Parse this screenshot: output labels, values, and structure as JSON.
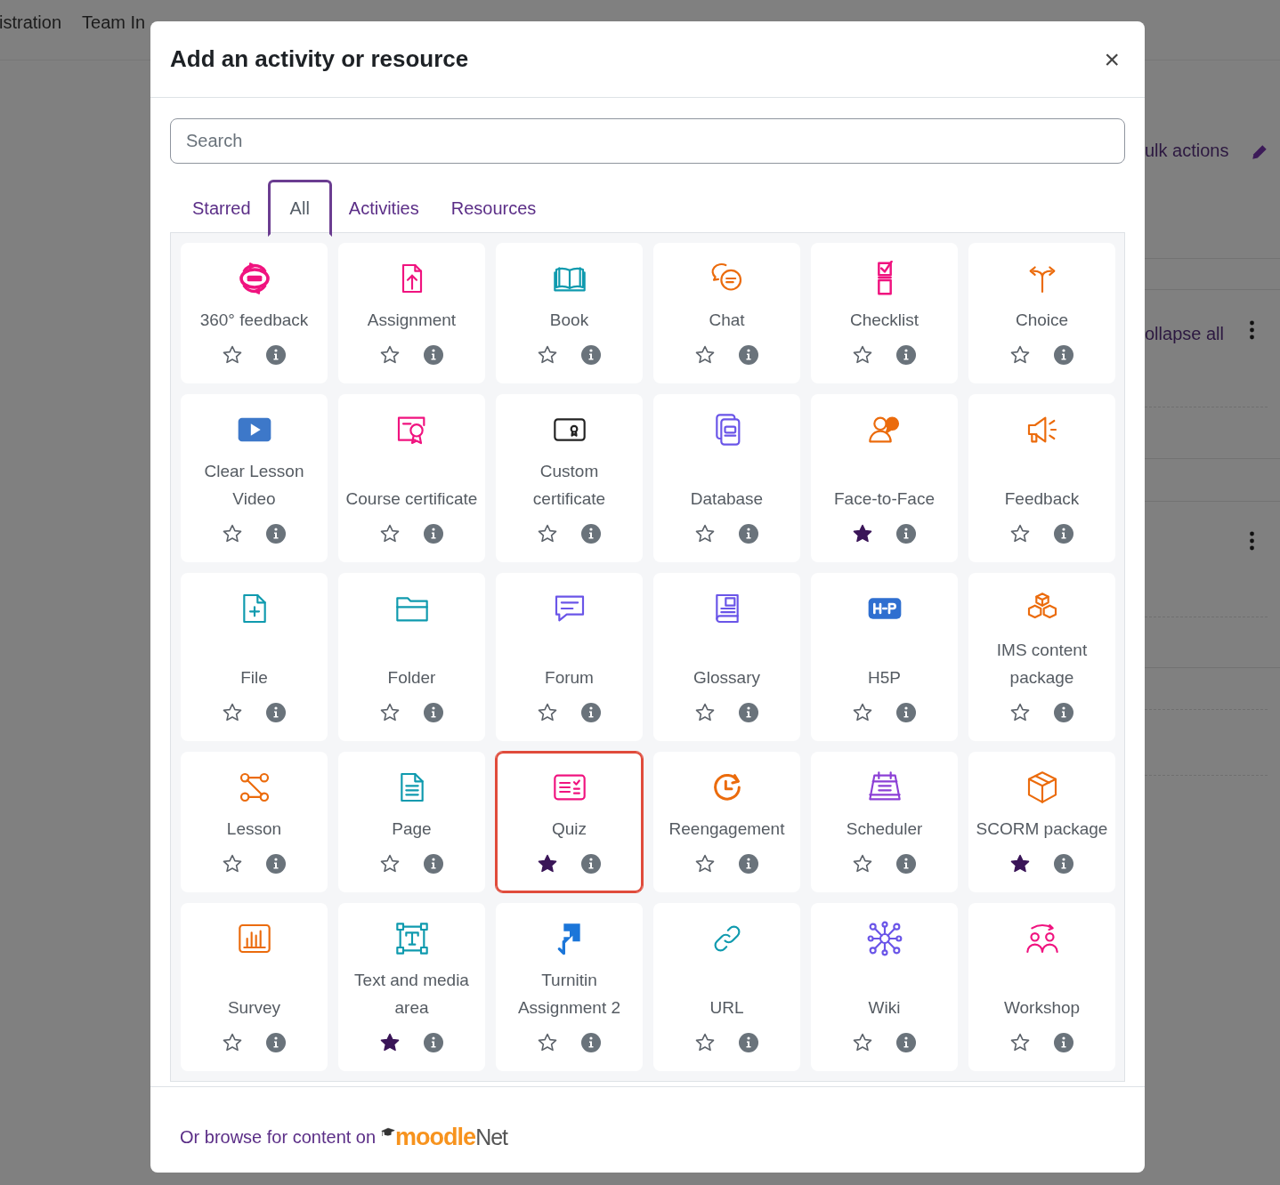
{
  "background": {
    "nav_items": [
      "istration",
      "Team In"
    ],
    "bulk_actions": "ulk actions",
    "collapse_all": "ollapse all"
  },
  "modal": {
    "title": "Add an activity or resource",
    "close": "×",
    "search": {
      "placeholder": "Search"
    },
    "tabs": [
      {
        "label": "Starred",
        "selected": false
      },
      {
        "label": "All",
        "selected": true
      },
      {
        "label": "Activities",
        "selected": false
      },
      {
        "label": "Resources",
        "selected": false
      }
    ],
    "items": [
      {
        "name": "360° feedback",
        "kind": "circular",
        "color": "#f0137f",
        "starred": false,
        "selected": false
      },
      {
        "name": "Assignment",
        "kind": "assign",
        "color": "#f0137f",
        "starred": false,
        "selected": false
      },
      {
        "name": "Book",
        "kind": "book",
        "color": "#0f9aae",
        "starred": false,
        "selected": false
      },
      {
        "name": "Chat",
        "kind": "chat",
        "color": "#eb6b0c",
        "starred": false,
        "selected": false
      },
      {
        "name": "Checklist",
        "kind": "checklist",
        "color": "#f0137f",
        "starred": false,
        "selected": false
      },
      {
        "name": "Choice",
        "kind": "choice",
        "color": "#eb6b0c",
        "starred": false,
        "selected": false
      },
      {
        "name": "Clear Lesson Video",
        "kind": "video",
        "color": "#3d78c9",
        "starred": false,
        "selected": false
      },
      {
        "name": "Course certificate",
        "kind": "cert",
        "color": "#f0137f",
        "starred": false,
        "selected": false
      },
      {
        "name": "Custom certificate",
        "kind": "custcert",
        "color": "#222222",
        "starred": false,
        "selected": false
      },
      {
        "name": "Database",
        "kind": "database",
        "color": "#6a55e8",
        "starred": false,
        "selected": false
      },
      {
        "name": "Face-to-Face",
        "kind": "people",
        "color": "#eb6b0c",
        "starred": true,
        "selected": false
      },
      {
        "name": "Feedback",
        "kind": "megaphone",
        "color": "#eb6b0c",
        "starred": false,
        "selected": false
      },
      {
        "name": "File",
        "kind": "file",
        "color": "#0f9aae",
        "starred": false,
        "selected": false
      },
      {
        "name": "Folder",
        "kind": "folder",
        "color": "#0f9aae",
        "starred": false,
        "selected": false
      },
      {
        "name": "Forum",
        "kind": "forum",
        "color": "#6a55e8",
        "starred": false,
        "selected": false
      },
      {
        "name": "Glossary",
        "kind": "glossary",
        "color": "#6a55e8",
        "starred": false,
        "selected": false
      },
      {
        "name": "H5P",
        "kind": "h5p",
        "color": "#2f6fd0",
        "starred": false,
        "selected": false
      },
      {
        "name": "IMS content package",
        "kind": "ims",
        "color": "#eb6b0c",
        "starred": false,
        "selected": false
      },
      {
        "name": "Lesson",
        "kind": "lesson",
        "color": "#eb6b0c",
        "starred": false,
        "selected": false
      },
      {
        "name": "Page",
        "kind": "page",
        "color": "#0f9aae",
        "starred": false,
        "selected": false
      },
      {
        "name": "Quiz",
        "kind": "quiz",
        "color": "#f0137f",
        "starred": true,
        "selected": true
      },
      {
        "name": "Reengagement",
        "kind": "reengage",
        "color": "#eb6b0c",
        "starred": false,
        "selected": false
      },
      {
        "name": "Scheduler",
        "kind": "calendar",
        "color": "#8c3fd6",
        "starred": false,
        "selected": false
      },
      {
        "name": "SCORM package",
        "kind": "scorm",
        "color": "#eb6b0c",
        "starred": true,
        "selected": false
      },
      {
        "name": "Survey",
        "kind": "survey",
        "color": "#eb6b0c",
        "starred": false,
        "selected": false
      },
      {
        "name": "Text and media area",
        "kind": "text",
        "color": "#0f9aae",
        "starred": true,
        "selected": false
      },
      {
        "name": "Turnitin Assignment 2",
        "kind": "turnitin",
        "color": "#1b76d9",
        "starred": false,
        "selected": false
      },
      {
        "name": "URL",
        "kind": "url",
        "color": "#0f9aae",
        "starred": false,
        "selected": false
      },
      {
        "name": "Wiki",
        "kind": "wiki",
        "color": "#6a55e8",
        "starred": false,
        "selected": false
      },
      {
        "name": "Workshop",
        "kind": "workshop",
        "color": "#f0137f",
        "starred": false,
        "selected": false
      }
    ],
    "footer": {
      "text": "Or browse for content on",
      "logo_primary": "moodle",
      "logo_secondary": "Net"
    }
  }
}
